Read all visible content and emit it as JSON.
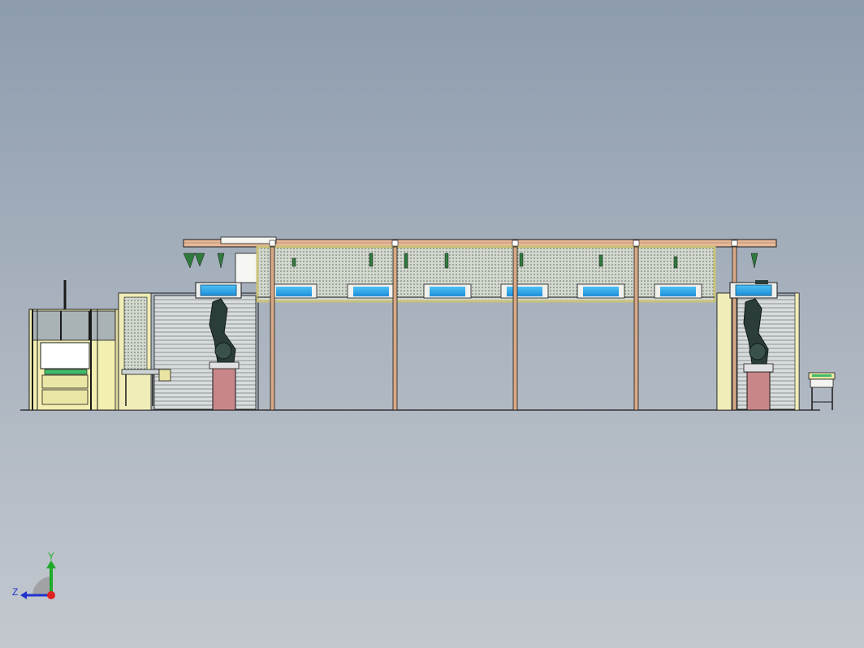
{
  "viewport": {
    "background_top": "#8d9cae",
    "background_bottom": "#c3c8ce"
  },
  "triad": {
    "y_label": "Y",
    "z_label": "Z",
    "y_color": "#1faa2a",
    "z_color": "#2233cc",
    "x_color": "#dd2222"
  },
  "colors": {
    "frame_yellow": "#f0edb8",
    "frame_outline": "#2a2a10",
    "beam_tan": "#e8b998",
    "post_tan": "#d8a987",
    "glass_blue": "#2aa7e8",
    "pedestal": "#c88486",
    "robot": "#2b3d3a",
    "mesh": "#c7cfc4"
  }
}
